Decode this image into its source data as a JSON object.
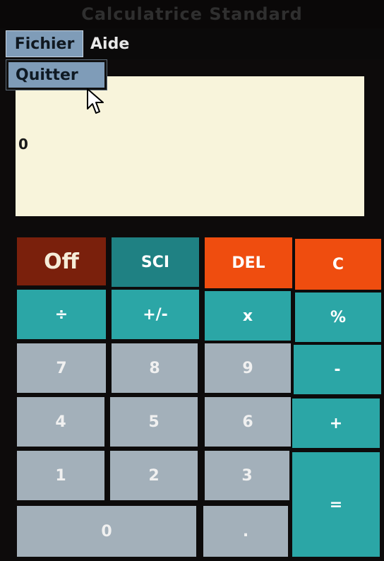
{
  "window": {
    "title": "Calculatrice Standard"
  },
  "menubar": {
    "fichier": "Fichier",
    "aide": "Aide"
  },
  "menu_fichier": {
    "items": [
      {
        "label": "Quitter"
      }
    ]
  },
  "display": {
    "value": "0"
  },
  "keys": {
    "off": "Off",
    "sci": "SCI",
    "del": "DEL",
    "c": "C",
    "divide": "÷",
    "negate": "+/-",
    "multiply": "x",
    "percent": "%",
    "seven": "7",
    "eight": "8",
    "nine": "9",
    "minus": "-",
    "four": "4",
    "five": "5",
    "six": "6",
    "plus": "+",
    "one": "1",
    "two": "2",
    "three": "3",
    "equals": "=",
    "zero": "0",
    "decimal": "."
  },
  "colors": {
    "display_bg": "#f8f4db",
    "off_bg": "#7a200c",
    "sci_bg": "#1f8183",
    "del_bg": "#ef4d0f",
    "c_bg": "#ef4d0f",
    "operator_bg": "#2ba6a6",
    "digit_bg": "#a3b0ba",
    "menu_highlight": "#7f9cb8"
  },
  "icons": {
    "cursor": "mouse-pointer-icon"
  }
}
